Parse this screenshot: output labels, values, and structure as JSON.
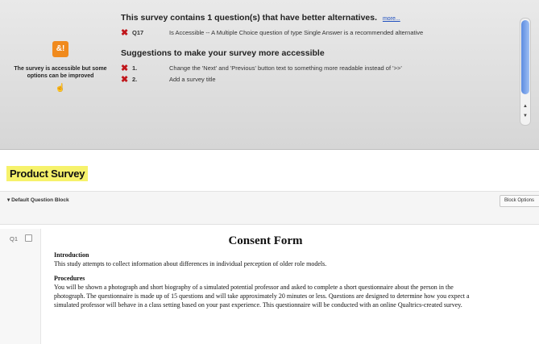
{
  "accessibility": {
    "warning_icon": "warning-badge-icon",
    "warning_icon_glyph": "&!",
    "status_text": "The survey is accessible but some options can be improved",
    "heading": "This survey contains 1 question(s) that have better alternatives.",
    "more_link": "more...",
    "issues": [
      {
        "id": "Q17",
        "text": "Is Accessible -- A Multiple Choice question of type Single Answer is a recommended alternative"
      }
    ],
    "suggestions_heading": "Suggestions to make your survey more accessible",
    "suggestions": [
      {
        "id": "1.",
        "text": "Change the 'Next' and 'Previous' button text to something more readable instead of '>>'"
      },
      {
        "id": "2.",
        "text": "Add a survey title"
      }
    ]
  },
  "survey": {
    "title": "Product Survey",
    "block_name": "▾ Default Question Block",
    "block_options": "Block Options"
  },
  "question": {
    "id": "Q1",
    "title": "Consent Form",
    "sections": [
      {
        "heading": "Introduction",
        "text": "This study attempts to collect information about differences in individual perception of older role models."
      },
      {
        "heading": "Procedures",
        "text": "You will be shown a photograph and short biography of a simulated potential professor and asked to complete a short questionnaire about the person in the photograph. The questionnaire is made up of 15 questions and will take approximately 20 minutes or less. Questions are designed to determine how you expect a simulated professor will behave in a class setting based on your past experience. This questionnaire will be conducted with an online Qualtrics-created survey."
      }
    ]
  }
}
